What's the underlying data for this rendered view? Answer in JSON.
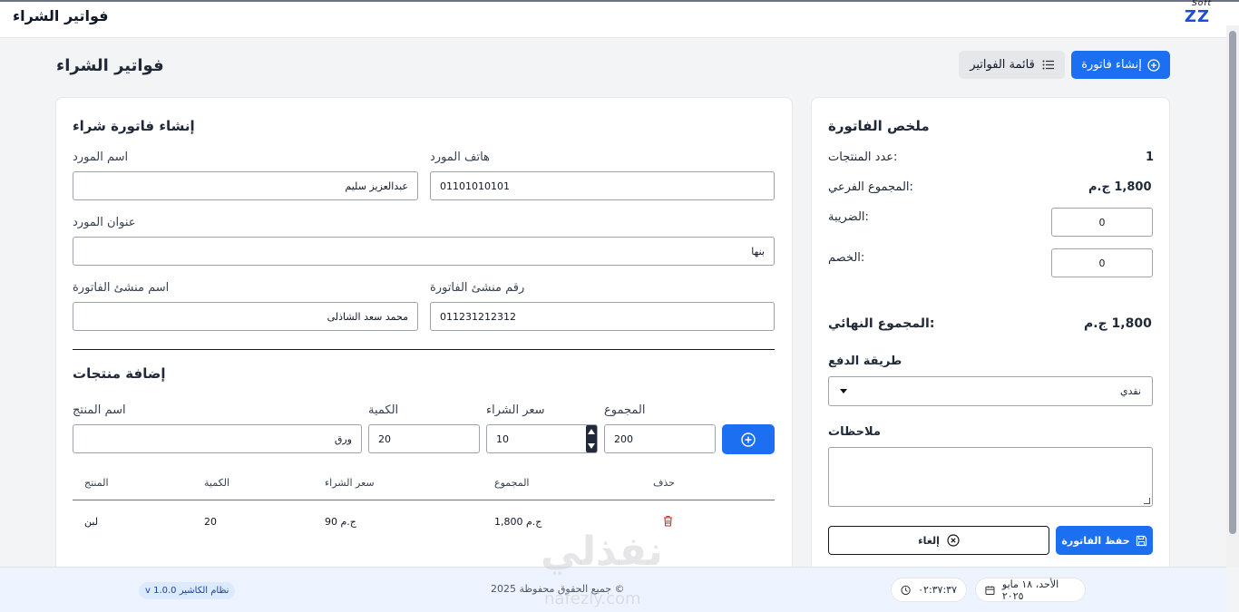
{
  "app": {
    "title": "فواتير الشراء",
    "logo": "ZZ",
    "logo_small": "Soft"
  },
  "header": {
    "page_title": "فواتير الشراء",
    "create_label": "إنشاء فاتورة",
    "list_label": "قائمة الفواتير"
  },
  "form": {
    "title": "إنشاء فاتورة شراء",
    "supplier_name_label": "اسم المورد",
    "supplier_name_value": "عبدالعزيز سليم",
    "supplier_phone_label": "هاتف المورد",
    "supplier_phone_value": "01101010101",
    "supplier_address_label": "عنوان المورد",
    "supplier_address_value": "بنها",
    "creator_name_label": "اسم منشئ الفاتورة",
    "creator_name_value": "محمد سعد الشاذلى",
    "creator_phone_label": "رقم منشئ الفاتورة",
    "creator_phone_value": "011231212312"
  },
  "products": {
    "title": "إضافة منتجات",
    "name_label": "اسم المنتج",
    "name_value": "ورق",
    "qty_label": "الكمية",
    "qty_value": "20",
    "price_label": "سعر الشراء",
    "price_value": "10",
    "total_label": "المجموع",
    "total_value": "200",
    "table": {
      "headers": {
        "product": "المنتج",
        "qty": "الكمية",
        "price": "سعر الشراء",
        "total": "المجموع",
        "delete": "حذف"
      },
      "rows": [
        {
          "product": "لبن",
          "qty": "20",
          "price": "90 ج.م",
          "total": "1,800 ج.م"
        }
      ]
    }
  },
  "summary": {
    "title": "ملخص الفاتورة",
    "count_label": "عدد المنتجات:",
    "count_value": "1",
    "subtotal_label": "المجموع الفرعي:",
    "subtotal_value": "1,800 ج.م",
    "tax_label": "الضريبة:",
    "tax_value": "0",
    "discount_label": "الخصم:",
    "discount_value": "0",
    "final_label": "المجموع النهائي:",
    "final_value": "1,800 ج.م",
    "payment_label": "طريقة الدفع",
    "payment_value": "نقدي",
    "notes_label": "ملاحظات",
    "save_label": "حفظ الفاتورة",
    "cancel_label": "إلغاء"
  },
  "footer": {
    "version": "v 1.0.0 نظام الكاشير",
    "copyright": "جميع الحقوق محفوظة 2025 ©",
    "time": "٠٢:٣٧:٣٧",
    "date": "الأحد، ١٨ مايو ٢٠٢٥"
  },
  "watermark": {
    "main": "نفذلي",
    "sub": "nafezly.com"
  },
  "colors": {
    "primary": "#1d6ff2",
    "delete": "#dc2626"
  }
}
